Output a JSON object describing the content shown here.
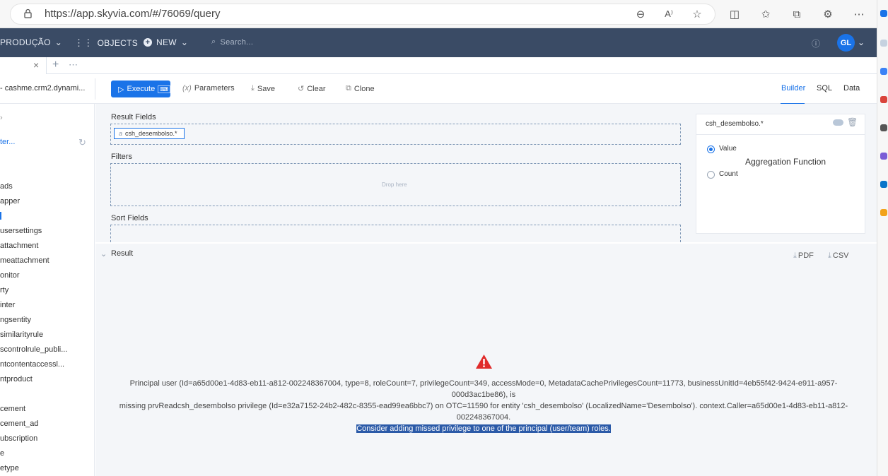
{
  "browser": {
    "url": "https://app.skyvia.com/#/76069/query"
  },
  "appbar": {
    "workspace": "PRODUÇÃO",
    "objects": "OBJECTS",
    "new": "NEW",
    "search_placeholder": "Search...",
    "avatar": "GL"
  },
  "toolbar": {
    "connection": "- cashme.crm2.dynami...",
    "execute": "Execute",
    "parameters": "Parameters",
    "save": "Save",
    "clear": "Clear",
    "clone": "Clone",
    "views": [
      "Builder",
      "SQL",
      "Data"
    ]
  },
  "sidebar": {
    "filter": "ter...",
    "items": [
      "ads",
      "apper",
      "",
      "usersettings",
      "attachment",
      "meattachment",
      "onitor",
      "rty",
      "inter",
      "ngsentity",
      "similarityrule",
      "scontrolrule_publi...",
      "ntcontentaccessl...",
      "ntproduct",
      "",
      "cement",
      "cement_ad",
      "ubscription",
      "e",
      "etype"
    ]
  },
  "builder": {
    "result_fields_label": "Result Fields",
    "chip_label": "csh_desembolso.*",
    "filters_label": "Filters",
    "drop_here": "Drop here",
    "sort_fields_label": "Sort Fields"
  },
  "properties": {
    "title": "csh_desembolso.*",
    "value_label": "Value",
    "count_label": "Count",
    "aggregation_label": "Aggregation Function"
  },
  "result": {
    "label": "Result",
    "pdf": "PDF",
    "csv": "CSV",
    "error_line1": "Principal user (Id=a65d00e1-4d83-eb11-a812-002248367004, type=8, roleCount=7, privilegeCount=349, accessMode=0, MetadataCachePrivilegesCount=11773, businessUnitId=4eb55f42-9424-e911-a957-000d3ac1be86), is",
    "error_line2": "missing prvReadcsh_desembolso privilege (Id=e32a7152-24b2-482c-8355-ead99ea6bbc7) on OTC=11590 for entity 'csh_desembolso' (LocalizedName='Desembolso'). context.Caller=a65d00e1-4d83-eb11-a812-002248367004.",
    "error_line3": "Consider adding missed privilege to one of the principal (user/team) roles."
  }
}
